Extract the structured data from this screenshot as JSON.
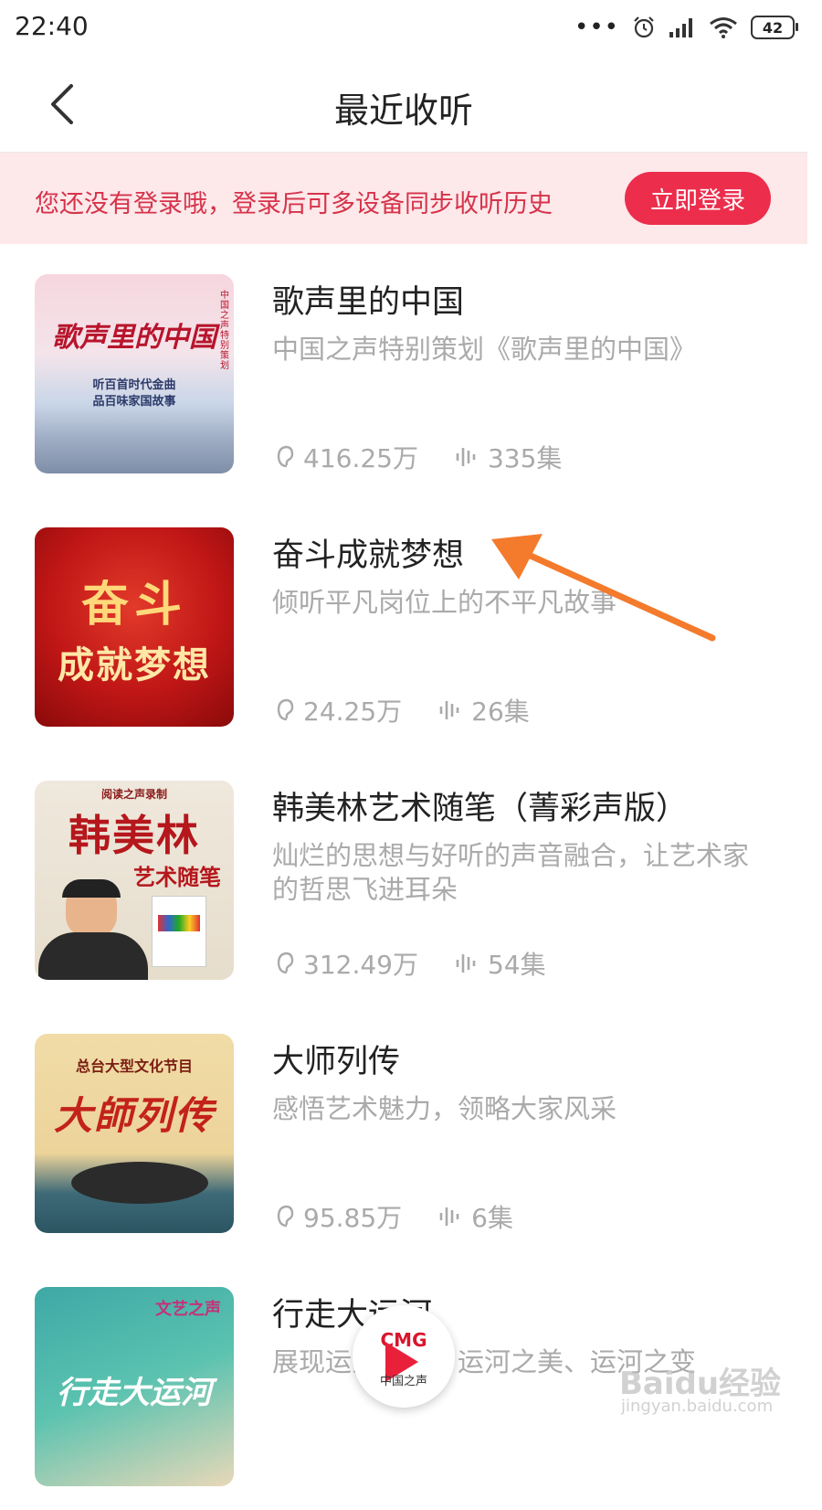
{
  "status_bar": {
    "time": "22:40",
    "battery": "42"
  },
  "header": {
    "title": "最近收听"
  },
  "login_banner": {
    "message": "您还没有登录哦，登录后可多设备同步收听历史",
    "button_label": "立即登录"
  },
  "items": [
    {
      "title": "歌声里的中国",
      "description": "中国之声特别策划《歌声里的中国》",
      "plays": "416.25万",
      "episodes": "335集",
      "cover_art": "歌声里的中国",
      "cover_sub1": "听百首时代金曲",
      "cover_sub2": "品百味家国故事",
      "cover_side": "中国之声特别策划"
    },
    {
      "title": "奋斗成就梦想",
      "description": "倾听平凡岗位上的不平凡故事",
      "plays": "24.25万",
      "episodes": "26集",
      "cover_art1": "奋斗",
      "cover_art2": "成就梦想"
    },
    {
      "title": "韩美林艺术随笔（菁彩声版）",
      "description": "灿烂的思想与好听的声音融合，让艺术家的哲思飞进耳朵",
      "plays": "312.49万",
      "episodes": "54集",
      "cover_tag": "阅读之声录制",
      "cover_art1": "韩美林",
      "cover_art2": "艺术随笔"
    },
    {
      "title": "大师列传",
      "description": "感悟艺术魅力，领略大家风采",
      "plays": "95.85万",
      "episodes": "6集",
      "cover_tag": "总台大型文化节目",
      "cover_art": "大師列传"
    },
    {
      "title": "行走大运河",
      "description": "展现运河之美、运河之美、运河之变",
      "cover_tag": "文艺之声",
      "cover_art": "行走大运河"
    }
  ],
  "player": {
    "logo": "CMG",
    "name": "中国之声"
  },
  "watermark": {
    "brand": "Baidu经验",
    "url": "jingyan.baidu.com"
  },
  "colors": {
    "accent": "#ec2d4c",
    "banner_bg": "#fde8ea",
    "arrow": "#f47a2c"
  }
}
